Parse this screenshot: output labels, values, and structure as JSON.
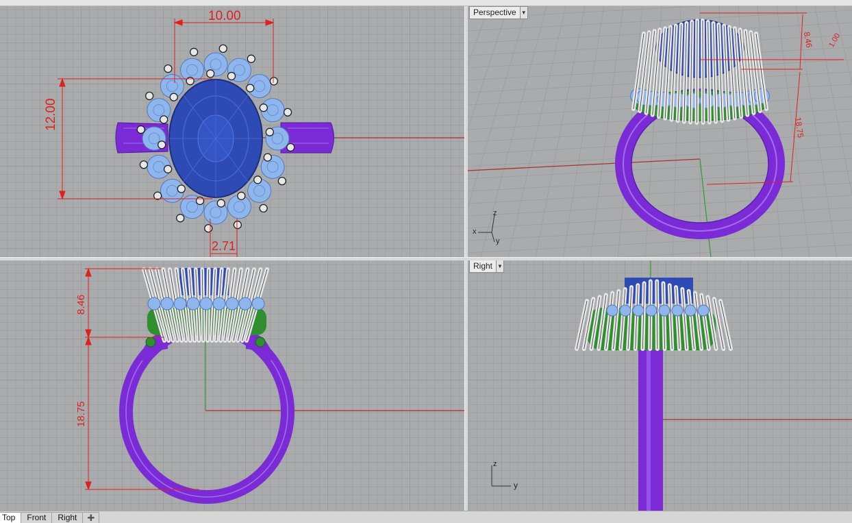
{
  "viewports": {
    "top": {
      "dims": {
        "width": "10.00",
        "height": "12.00",
        "stone_gap": "2.71"
      }
    },
    "perspective": {
      "label": "Perspective",
      "dims": {
        "crown": "8.46",
        "shank": "18.75",
        "small": "1.00"
      },
      "axis": {
        "z": "z",
        "x": "x",
        "y": "y"
      }
    },
    "front": {
      "dims": {
        "crown": "8.46",
        "shank": "18.75"
      }
    },
    "right": {
      "label": "Right",
      "axis": {
        "z": "z",
        "y": "y"
      }
    }
  },
  "tabs": [
    {
      "label": "Top",
      "active": true
    },
    {
      "label": "Front",
      "active": false
    },
    {
      "label": "Right",
      "active": false
    }
  ],
  "add_tab_icon": "plus-icon",
  "colors": {
    "viewport_bg": "#a9abad",
    "dimension_red": "#e0201c",
    "gem_blue": "#2e4fb8",
    "accent_stone": "#8fb6ec",
    "shank_purple": "#7a2bd6",
    "setting_green": "#2f8f2f",
    "x_axis": "#a8322c",
    "y_axis": "#3a9a3a"
  }
}
